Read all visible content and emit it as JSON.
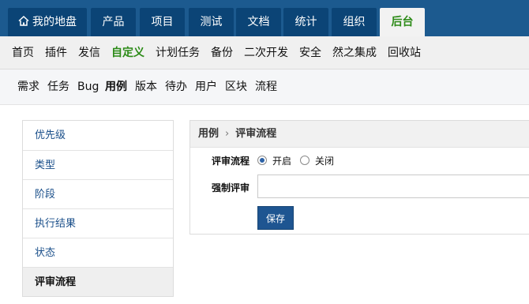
{
  "top_nav": {
    "tabs": [
      "我的地盘",
      "产品",
      "项目",
      "测试",
      "文档",
      "统计",
      "组织",
      "后台"
    ],
    "active": "后台"
  },
  "sub_nav": {
    "items": [
      "首页",
      "插件",
      "发信",
      "自定义",
      "计划任务",
      "备份",
      "二次开发",
      "安全",
      "然之集成",
      "回收站"
    ],
    "active": "自定义"
  },
  "third_nav": {
    "items": [
      "需求",
      "任务",
      "Bug",
      "用例",
      "版本",
      "待办",
      "用户",
      "区块",
      "流程"
    ],
    "active": "用例"
  },
  "side_list": {
    "items": [
      "优先级",
      "类型",
      "阶段",
      "执行结果",
      "状态",
      "评审流程"
    ],
    "active": "评审流程"
  },
  "panel": {
    "breadcrumb": {
      "parent": "用例",
      "separator": "›",
      "current": "评审流程"
    },
    "review_flow_label": "评审流程",
    "option_on": "开启",
    "option_off": "关闭",
    "selected": "开启",
    "force_review_label": "强制评审",
    "force_review_value": "",
    "save_label": "保存"
  },
  "colors": {
    "top_nav_bg": "#1c5a8f",
    "tab_bg": "#0b4476",
    "active_green": "#2b8a16",
    "link_blue": "#1a4f8a",
    "button_blue": "#1e5591"
  }
}
